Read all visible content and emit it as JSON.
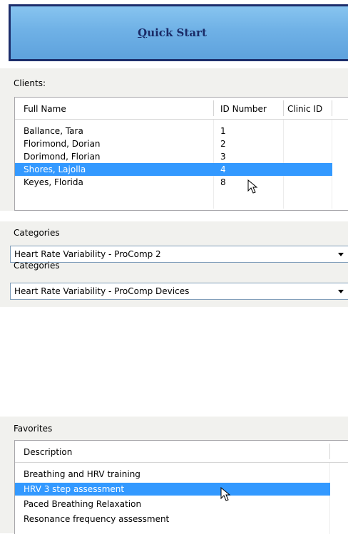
{
  "quick_start": {
    "label_underlined": "Q",
    "label_rest": "uick Start"
  },
  "clients": {
    "title": "Clients:",
    "columns": [
      "Full Name",
      "ID Number",
      "Clinic ID"
    ],
    "rows": [
      {
        "name": "Ballance, Tara",
        "id": "1",
        "clinic": "",
        "selected": false
      },
      {
        "name": "Florimond, Dorian",
        "id": "2",
        "clinic": "",
        "selected": false
      },
      {
        "name": "Dorimond, Florian",
        "id": "3",
        "clinic": "",
        "selected": false
      },
      {
        "name": "Shores, Lajolla",
        "id": "4",
        "clinic": "",
        "selected": true
      },
      {
        "name": "Keyes, Florida",
        "id": "8",
        "clinic": "",
        "selected": false
      }
    ]
  },
  "categories1": {
    "title": "Categories",
    "value": "Heart Rate Variability - ProComp 2"
  },
  "categories2": {
    "title": "Categories",
    "value": "Heart Rate Variability - ProComp Devices"
  },
  "favorites": {
    "title": "Favorites",
    "columns": [
      "Description"
    ],
    "rows": [
      {
        "description": "Breathing and HRV training",
        "selected": false
      },
      {
        "description": "HRV 3 step assessment",
        "selected": true
      },
      {
        "description": "Paced Breathing Relaxation",
        "selected": false
      },
      {
        "description": "Resonance frequency assessment",
        "selected": false
      }
    ]
  },
  "colors": {
    "selection": "#3399ff",
    "button_border": "#1c2d6b",
    "button_fill": "#6fb1e6"
  },
  "icons": {
    "cursor": "arrow-pointer-icon",
    "dropdown": "chevron-down-icon"
  }
}
